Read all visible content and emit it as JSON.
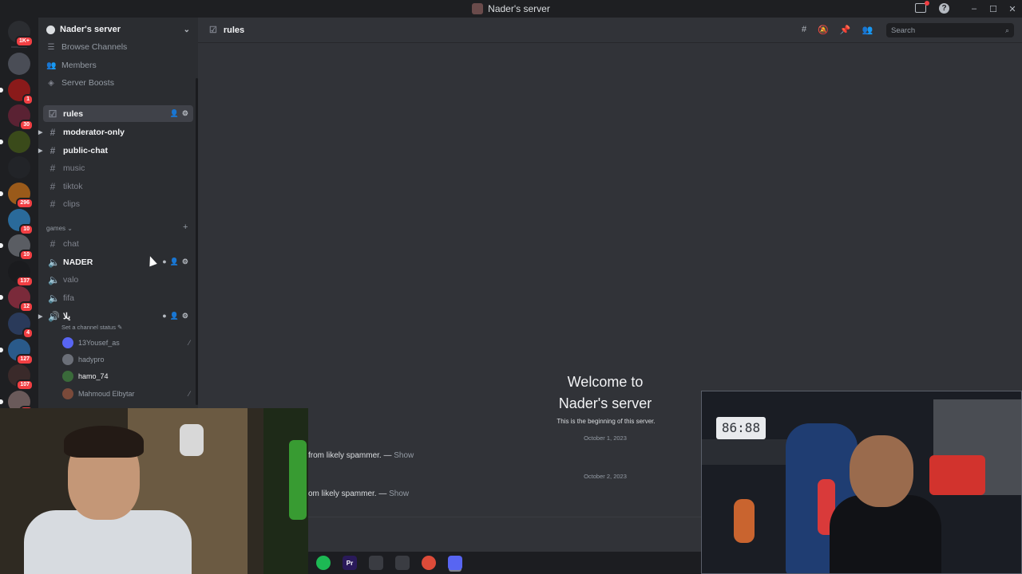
{
  "window": {
    "title": "Nader's server",
    "controls": [
      "–",
      "☐",
      "✕"
    ]
  },
  "servers": [
    {
      "icon": "home-icon",
      "badge": "1K+",
      "color": "#2b2d31"
    },
    {
      "icon": "server-icon",
      "badge": "",
      "color": "#4a4d56"
    },
    {
      "icon": "server-icon",
      "badge": "1",
      "color": "#8a1a1a"
    },
    {
      "icon": "server-icon",
      "badge": "30",
      "color": "#5a2233"
    },
    {
      "icon": "server-icon",
      "badge": "",
      "color": "#3a4a1a"
    },
    {
      "icon": "server-icon",
      "badge": "",
      "color": "#222428"
    },
    {
      "icon": "server-icon",
      "badge": "296",
      "color": "#9a5a1a"
    },
    {
      "icon": "server-icon",
      "badge": "10",
      "color": "#2a6a9a"
    },
    {
      "icon": "server-icon",
      "badge": "10",
      "color": "#5a5d63"
    },
    {
      "icon": "server-icon",
      "badge": "137",
      "color": "#1a1b1e"
    },
    {
      "icon": "server-icon",
      "badge": "12",
      "color": "#7a2a3a"
    },
    {
      "icon": "server-icon",
      "badge": "4",
      "color": "#2a3a5a"
    },
    {
      "icon": "server-icon",
      "badge": "127",
      "color": "#2a5a8a"
    },
    {
      "icon": "server-icon",
      "badge": "107",
      "color": "#3a2a2a"
    },
    {
      "icon": "server-icon",
      "badge": "33",
      "color": "#6a5a5a"
    }
  ],
  "sidebar": {
    "server_name": "Nader's server",
    "nav": [
      {
        "icon": "browse-channels-icon",
        "label": "Browse Channels"
      },
      {
        "icon": "members-icon",
        "label": "Members"
      },
      {
        "icon": "server-boosts-icon",
        "label": "Server Boosts"
      }
    ],
    "channels": [
      {
        "label": "rules",
        "kind": "rules"
      },
      {
        "label": "moderator-only",
        "kind": "text"
      },
      {
        "label": "public-chat",
        "kind": "text"
      },
      {
        "label": "music",
        "kind": "text"
      },
      {
        "label": "tiktok",
        "kind": "text"
      },
      {
        "label": "clips",
        "kind": "text"
      }
    ],
    "category": "games",
    "game_channels": [
      {
        "label": "chat",
        "kind": "text"
      },
      {
        "label": "NADER",
        "kind": "voice"
      },
      {
        "label": "valo",
        "kind": "voice"
      },
      {
        "label": "fifa",
        "kind": "voice"
      },
      {
        "label": "يلا",
        "kind": "voice"
      }
    ],
    "channel_status": "Set a channel status",
    "voice_users": [
      {
        "name": "13Yousef_as",
        "color": "#5865f2",
        "muted": true
      },
      {
        "name": "hadypro",
        "color": "#6b6f78",
        "muted": false
      },
      {
        "name": "hamo_74",
        "color": "#3a6a3a",
        "muted": false
      },
      {
        "name": "Mahmoud Elbytar",
        "color": "#7a4a3a",
        "muted": true
      }
    ]
  },
  "main": {
    "channel": "rules",
    "search_placeholder": "Search",
    "welcome_line1": "Welcome to",
    "welcome_line2": "Nader's server",
    "beginning": "This is the beginning of this server.",
    "date1": "October 1, 2023",
    "date2": "October 2, 2023",
    "spam1": "from likely spammer. —",
    "spam2": "om likely spammer. —",
    "show": "Show"
  },
  "webcam_right": {
    "clock": "86:88"
  },
  "taskbar": [
    {
      "icon": "spotify-icon",
      "label": "",
      "color": "#1db954"
    },
    {
      "icon": "premiere-icon",
      "label": "Pr",
      "color": "#2a1a5a"
    },
    {
      "icon": "app-icon",
      "label": "",
      "color": "#3a3c42"
    },
    {
      "icon": "obs-icon",
      "label": "",
      "color": "#3a3c42"
    },
    {
      "icon": "chrome-icon",
      "label": "",
      "color": "#dd4b39"
    },
    {
      "icon": "discord-icon",
      "label": "",
      "color": "#5865f2"
    }
  ]
}
